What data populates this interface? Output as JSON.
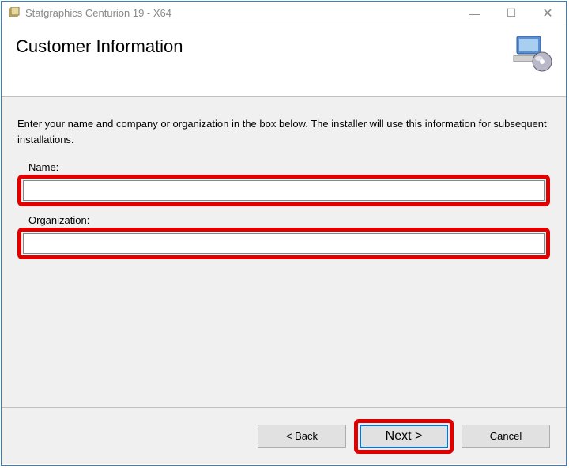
{
  "window": {
    "title": "Statgraphics Centurion 19 - X64"
  },
  "header": {
    "title": "Customer Information"
  },
  "content": {
    "instruction": "Enter your name and company or organization in the box below. The installer will use this information for subsequent installations.",
    "name_label": "Name:",
    "name_value": "",
    "org_label": "Organization:",
    "org_value": ""
  },
  "buttons": {
    "back": "< Back",
    "next": "Next >",
    "cancel": "Cancel"
  },
  "controls": {
    "minimize": "—",
    "maximize": "☐",
    "close": "✕"
  }
}
